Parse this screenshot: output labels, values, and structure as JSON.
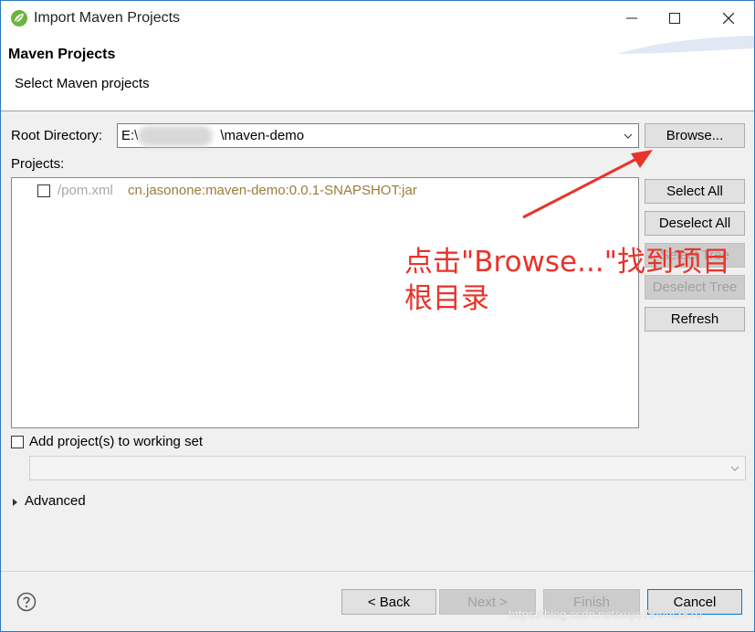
{
  "window": {
    "title": "Import Maven Projects"
  },
  "header": {
    "title": "Maven Projects",
    "description": "Select Maven projects"
  },
  "root_directory": {
    "label": "Root Directory:",
    "value_prefix": "E:\\",
    "value_suffix": "\\maven-demo",
    "browse_label": "Browse..."
  },
  "projects": {
    "label": "Projects:",
    "items": [
      {
        "path": "/pom.xml",
        "artifact": "cn.jasonone:maven-demo:0.0.1-SNAPSHOT:jar",
        "checked": false
      }
    ]
  },
  "side_buttons": {
    "select_all": "Select All",
    "deselect_all": "Deselect All",
    "select_tree": "Select Tree",
    "deselect_tree": "Deselect Tree",
    "refresh": "Refresh"
  },
  "working_set": {
    "label": "Add project(s) to working set",
    "checked": false,
    "value": ""
  },
  "advanced": {
    "label": "Advanced"
  },
  "annotation": {
    "line1": "点击\"Browse...\"找到项目",
    "line2": "根目录",
    "color": "#e8332a"
  },
  "footer": {
    "back_label": "< Back",
    "next_label": "Next >",
    "finish_label": "Finish",
    "cancel_label": "Cancel"
  },
  "watermark": "https://blog.csdn.net/xujie784442870"
}
